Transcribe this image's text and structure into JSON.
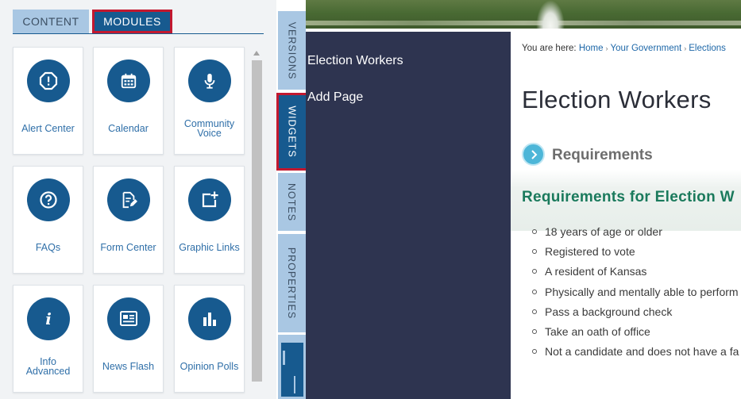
{
  "top_tabs": {
    "content_label": "CONTENT",
    "modules_label": "MODULES"
  },
  "modules": [
    {
      "label": "Alert Center",
      "icon": "alert-icon"
    },
    {
      "label": "Calendar",
      "icon": "calendar-icon"
    },
    {
      "label": "Community Voice",
      "icon": "microphone-icon"
    },
    {
      "label": "FAQs",
      "icon": "question-icon"
    },
    {
      "label": "Form Center",
      "icon": "form-edit-icon"
    },
    {
      "label": "Graphic Links",
      "icon": "graphic-link-add-icon"
    },
    {
      "label": "Info Advanced",
      "icon": "info-icon"
    },
    {
      "label": "News Flash",
      "icon": "news-icon"
    },
    {
      "label": "Opinion Polls",
      "icon": "bar-chart-icon"
    }
  ],
  "vertical_tabs": {
    "versions": "VERSIONS",
    "widgets": "WIDGETS",
    "notes": "NOTES",
    "properties": "PROPERTIES"
  },
  "nav": {
    "election_workers": "Election Workers",
    "add_page": "Add Page"
  },
  "breadcrumb": {
    "prefix": "You are here:",
    "items": [
      "Home",
      "Your Government",
      "Elections"
    ],
    "separator": "›"
  },
  "page": {
    "title": "Election Workers",
    "requirements_heading": "Requirements",
    "requirements_subheading": "Requirements for Election W",
    "requirements": [
      "18 years of age or older",
      "Registered to vote",
      "A resident of Kansas",
      "Physically and mentally able to perform",
      "Pass a background check",
      "Take an oath of office",
      "Not a candidate and does not have a fa"
    ]
  },
  "colors": {
    "primary": "#175a8f",
    "tab_inactive": "#a9c7e3",
    "highlight": "#c2182f",
    "nav_bg": "#2e3450",
    "subheading": "#1a7a5c",
    "link": "#1d67a8"
  }
}
